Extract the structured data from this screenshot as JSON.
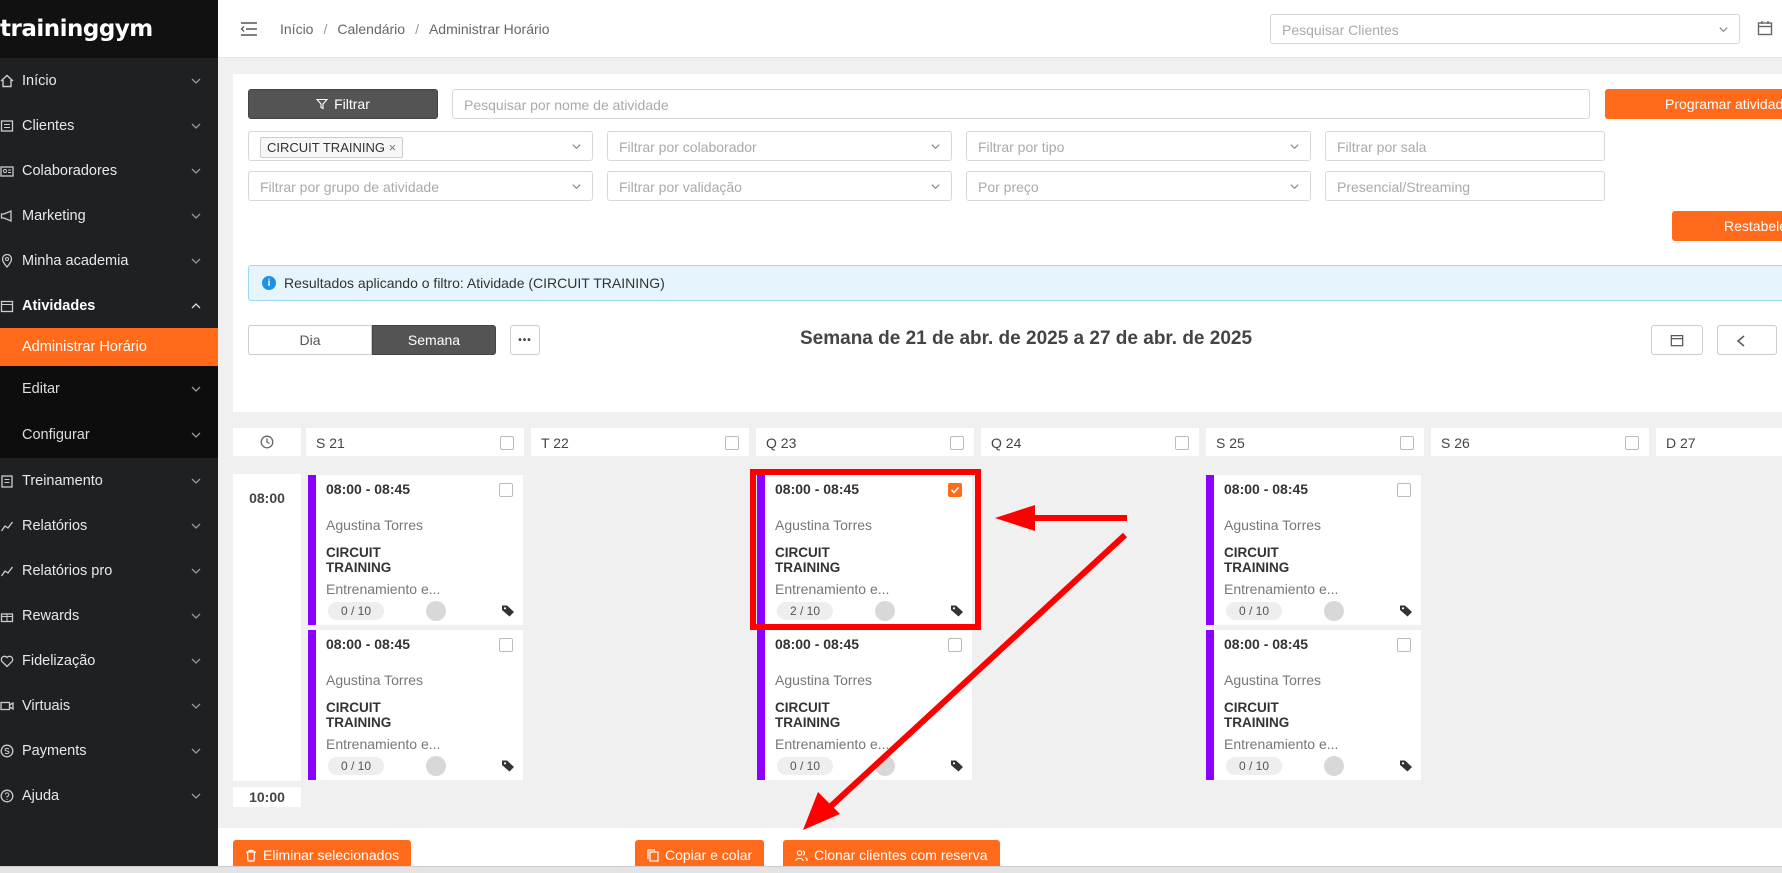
{
  "brand": {
    "logo_text": "traininggym"
  },
  "sidebar": {
    "items": [
      {
        "label": "Início",
        "icon": "home-icon"
      },
      {
        "label": "Clientes",
        "icon": "clients-icon"
      },
      {
        "label": "Colaboradores",
        "icon": "id-card-icon"
      },
      {
        "label": "Marketing",
        "icon": "megaphone-icon"
      },
      {
        "label": "Minha academia",
        "icon": "location-icon"
      },
      {
        "label": "Atividades",
        "icon": "calendar-icon",
        "expanded": true
      }
    ],
    "sub_items": [
      {
        "label": "Administrar Horário",
        "active": true
      },
      {
        "label": "Editar"
      },
      {
        "label": "Configurar"
      }
    ],
    "items_after": [
      {
        "label": "Treinamento",
        "icon": "clipboard-icon"
      },
      {
        "label": "Relatórios",
        "icon": "chart-icon"
      },
      {
        "label": "Relatórios pro",
        "icon": "chart-icon"
      },
      {
        "label": "Rewards",
        "icon": "gift-icon"
      },
      {
        "label": "Fidelização",
        "icon": "heart-icon"
      },
      {
        "label": "Virtuais",
        "icon": "video-icon"
      },
      {
        "label": "Payments",
        "icon": "dollar-icon"
      },
      {
        "label": "Ajuda",
        "icon": "help-icon"
      }
    ]
  },
  "header": {
    "breadcrumb": [
      "Início",
      "Calendário",
      "Administrar Horário"
    ],
    "client_search_placeholder": "Pesquisar Clientes"
  },
  "filters": {
    "filter_button": "Filtrar",
    "activity_search_placeholder": "Pesquisar por nome de atividade",
    "program_button": "Programar atividade",
    "activity_tag": "CIRCUIT TRAINING",
    "collaborator_placeholder": "Filtrar por colaborador",
    "type_placeholder": "Filtrar por tipo",
    "room_placeholder": "Filtrar por sala",
    "group_placeholder": "Filtrar por grupo de atividade",
    "validation_placeholder": "Filtrar por validação",
    "price_placeholder": "Por preço",
    "mode_placeholder": "Presencial/Streaming",
    "reset_button": "Restabelecer"
  },
  "info": {
    "message": "Resultados aplicando o filtro: Atividade (CIRCUIT TRAINING)"
  },
  "view": {
    "day_label": "Dia",
    "week_label": "Semana",
    "more_label": "•••",
    "week_title": "Semana de 21 de abr. de 2025 a 27 de abr. de 2025"
  },
  "calendar": {
    "days": [
      "S 21",
      "T 22",
      "Q 23",
      "Q 24",
      "S 25",
      "S 26",
      "D 27"
    ],
    "times": [
      "08:00",
      "10:00"
    ],
    "cards": [
      {
        "day": "S 21",
        "time": "08:00 - 08:45",
        "coach": "Agustina Torres",
        "name": "CIRCUIT TRAINING",
        "desc": "Entrenamiento e...",
        "capacity": "0 / 10",
        "checked": false
      },
      {
        "day": "S 21",
        "time": "08:00 - 08:45",
        "coach": "Agustina Torres",
        "name": "CIRCUIT TRAINING",
        "desc": "Entrenamiento e...",
        "capacity": "0 / 10",
        "checked": false
      },
      {
        "day": "Q 23",
        "time": "08:00 - 08:45",
        "coach": "Agustina Torres",
        "name": "CIRCUIT TRAINING",
        "desc": "Entrenamiento e...",
        "capacity": "2 / 10",
        "checked": true
      },
      {
        "day": "Q 23",
        "time": "08:00 - 08:45",
        "coach": "Agustina Torres",
        "name": "CIRCUIT TRAINING",
        "desc": "Entrenamiento e...",
        "capacity": "0 / 10",
        "checked": false
      },
      {
        "day": "S 25",
        "time": "08:00 - 08:45",
        "coach": "Agustina Torres",
        "name": "CIRCUIT TRAINING",
        "desc": "Entrenamiento e...",
        "capacity": "0 / 10",
        "checked": false
      },
      {
        "day": "S 25",
        "time": "08:00 - 08:45",
        "coach": "Agustina Torres",
        "name": "CIRCUIT TRAINING",
        "desc": "Entrenamiento e...",
        "capacity": "0 / 10",
        "checked": false
      }
    ]
  },
  "actions": {
    "delete_selected": "Eliminar selecionados",
    "copy_paste": "Copiar e colar",
    "clone_clients": "Clonar clientes com reserva"
  },
  "colors": {
    "accent": "#ff6b1a",
    "sidebar_bg": "#1f2022",
    "card_stripe": "#8b00ff",
    "annotation_red": "#ff0000"
  }
}
